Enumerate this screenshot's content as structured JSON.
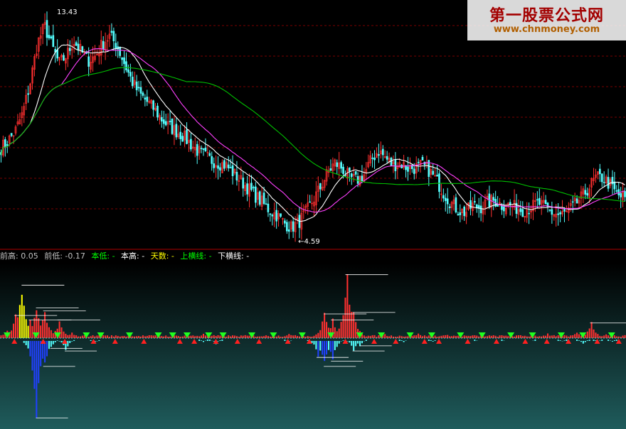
{
  "chart_data": [
    {
      "type": "candlestick",
      "panel": "price",
      "max_label": "13.43",
      "min_label": "4.59",
      "ylim": [
        4.3,
        14.0
      ],
      "price_close": [
        8.2,
        8.5,
        8.9,
        9.6,
        10.8,
        12.4,
        13.1,
        12.3,
        11.6,
        11.9,
        12.5,
        12.1,
        11.7,
        11.9,
        12.4,
        12.7,
        12.3,
        11.6,
        10.9,
        10.4,
        10.1,
        9.8,
        9.4,
        9.1,
        8.9,
        8.7,
        8.4,
        8.1,
        7.9,
        7.7,
        7.6,
        7.5,
        7.2,
        6.9,
        6.6,
        6.3,
        6.0,
        5.7,
        5.5,
        5.2,
        5.0,
        5.2,
        5.6,
        6.1,
        6.6,
        7.2,
        7.6,
        7.4,
        7.0,
        6.9,
        7.1,
        7.7,
        8.1,
        7.8,
        7.5,
        7.6,
        7.4,
        7.4,
        7.5,
        7.3,
        6.9,
        6.4,
        6.0,
        5.7,
        5.6,
        5.9,
        5.8,
        6.0,
        6.1,
        5.9,
        5.9,
        5.8,
        5.7,
        5.8,
        6.0,
        5.8,
        5.6,
        5.5,
        5.6,
        5.9,
        6.2,
        6.6,
        7.0,
        7.0,
        6.7,
        6.3,
        6.2
      ],
      "ma_series": [
        {
          "color": "#ffffff",
          "window": 5
        },
        {
          "color": "#ff40ff",
          "window": 10
        },
        {
          "color": "#00c000",
          "window": 30
        }
      ]
    },
    {
      "type": "bar",
      "panel": "indicator",
      "legend": [
        {
          "label": "前高: 0.05",
          "color": "#c0c0c0"
        },
        {
          "label": "前低: -0.17",
          "color": "#c0c0c0"
        },
        {
          "label": "本低: -",
          "color": "#00ff00"
        },
        {
          "label": "本高: -",
          "color": "#ffffff"
        },
        {
          "label": "天数: -",
          "color": "#ffff00"
        },
        {
          "label": "上横线: -",
          "color": "#00ff00"
        },
        {
          "label": "下横线: -",
          "color": "#ffffff"
        }
      ],
      "positive_peaks": [
        [
          1,
          0.05
        ],
        [
          2,
          0.15
        ],
        [
          3,
          0.35
        ],
        [
          4,
          0.12
        ],
        [
          5,
          0.2
        ],
        [
          6,
          0.18
        ],
        [
          7,
          0.06
        ],
        [
          8,
          0.12
        ],
        [
          10,
          0.04
        ],
        [
          14,
          0.03
        ],
        [
          18,
          0.02
        ],
        [
          28,
          0.03
        ],
        [
          34,
          0.02
        ],
        [
          40,
          0.03
        ],
        [
          45,
          0.16
        ],
        [
          46,
          0.12
        ],
        [
          48,
          0.42
        ],
        [
          49,
          0.17
        ],
        [
          50,
          0.05
        ],
        [
          53,
          0.04
        ],
        [
          58,
          0.03
        ],
        [
          62,
          0.02
        ],
        [
          67,
          0.02
        ],
        [
          72,
          0.02
        ],
        [
          76,
          0.03
        ],
        [
          80,
          0.04
        ],
        [
          82,
          0.1
        ],
        [
          84,
          0.03
        ]
      ],
      "negative_peaks": [
        [
          5,
          -0.62
        ],
        [
          6,
          -0.22
        ],
        [
          7,
          -0.08
        ],
        [
          9,
          -0.1
        ],
        [
          13,
          -0.04
        ],
        [
          28,
          -0.03
        ],
        [
          30,
          -0.05
        ],
        [
          40,
          -0.03
        ],
        [
          44,
          -0.15
        ],
        [
          45,
          -0.22
        ],
        [
          46,
          -0.18
        ],
        [
          49,
          -0.1
        ],
        [
          50,
          -0.06
        ],
        [
          56,
          -0.03
        ],
        [
          60,
          -0.03
        ],
        [
          66,
          -0.02
        ],
        [
          70,
          -0.02
        ],
        [
          74,
          -0.02
        ],
        [
          78,
          -0.03
        ],
        [
          81,
          -0.05
        ],
        [
          83,
          -0.03
        ],
        [
          85,
          -0.03
        ]
      ],
      "up_markers": [
        2,
        6,
        9,
        13,
        16,
        20,
        25,
        27,
        30,
        33,
        36,
        40,
        43,
        48,
        52,
        55,
        59,
        61,
        65,
        69,
        73,
        76,
        79,
        83,
        86
      ],
      "down_markers": [
        1,
        5,
        8,
        12,
        14,
        18,
        22,
        24,
        26,
        29,
        31,
        35,
        38,
        42,
        46,
        50,
        53,
        57,
        60,
        64,
        67,
        71,
        74,
        78,
        81,
        85
      ],
      "ylim": [
        -0.65,
        0.45
      ]
    }
  ]
}
